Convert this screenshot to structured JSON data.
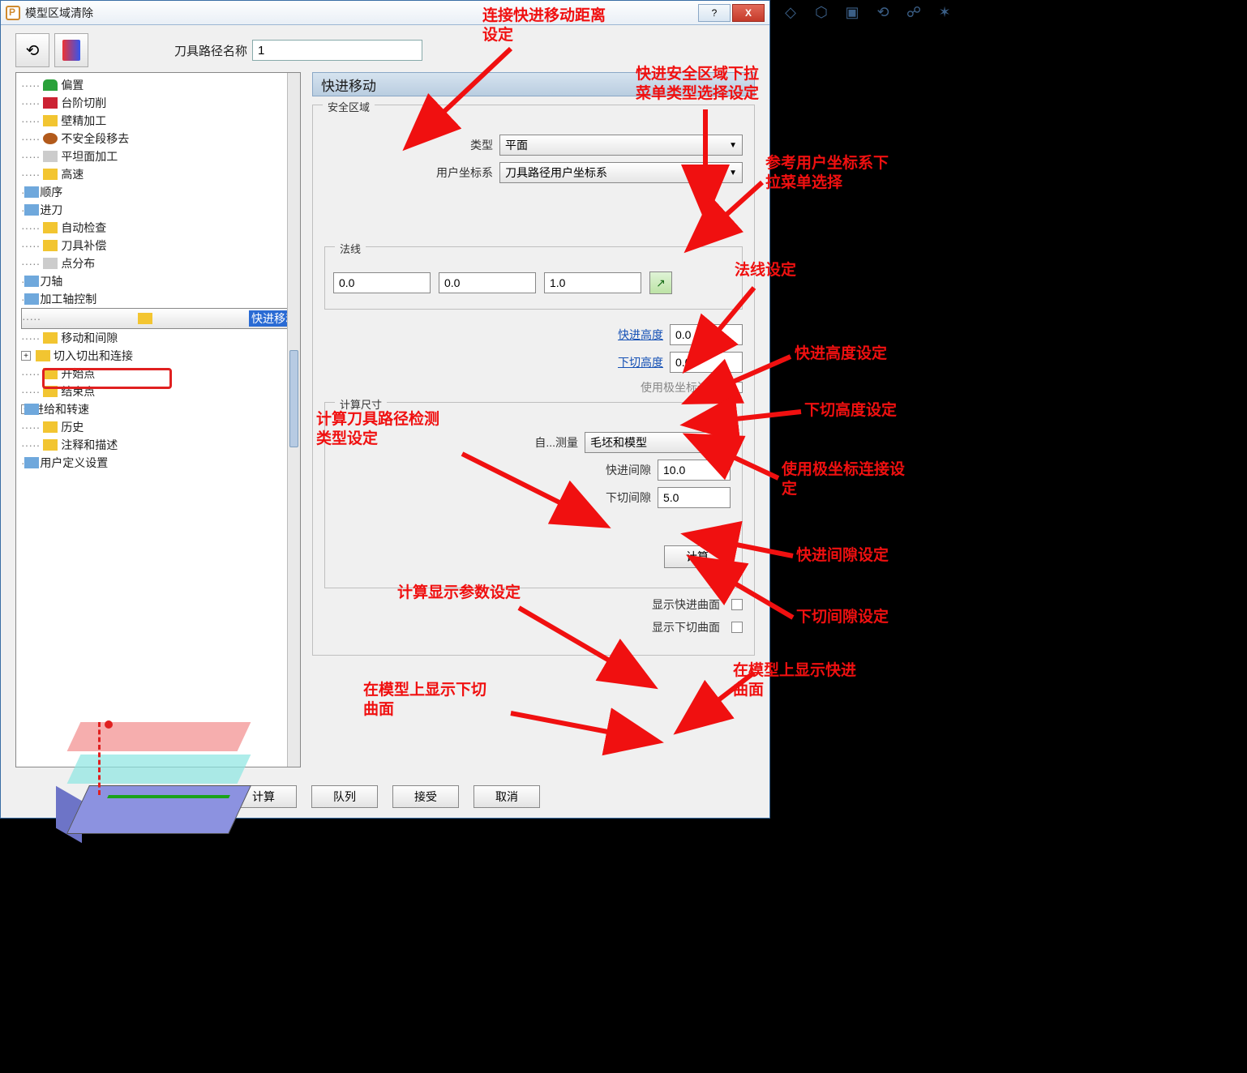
{
  "window": {
    "title": "模型区域清除",
    "help_glyph": "?",
    "close_glyph": "X"
  },
  "toolbar": {
    "name_label": "刀具路径名称",
    "name_value": "1"
  },
  "tree": {
    "items": [
      {
        "label": "偏置",
        "icon": "green"
      },
      {
        "label": "台阶切削",
        "icon": "stair"
      },
      {
        "label": "壁精加工",
        "icon": "yellow"
      },
      {
        "label": "不安全段移去",
        "icon": "brown"
      },
      {
        "label": "平坦面加工",
        "icon": "hash"
      },
      {
        "label": "高速",
        "icon": "fast"
      },
      {
        "label": "顺序",
        "icon": "arrow"
      },
      {
        "label": "进刀",
        "icon": "arrow"
      },
      {
        "label": "自动检查",
        "icon": "yellow"
      },
      {
        "label": "刀具补偿",
        "icon": "yellow"
      },
      {
        "label": "点分布",
        "icon": "hash"
      },
      {
        "label": "刀轴",
        "icon": "arrow"
      },
      {
        "label": "加工轴控制",
        "icon": "arrow"
      },
      {
        "label": "快进移动",
        "icon": "fast",
        "selected": true
      },
      {
        "label": "移动和间隙",
        "icon": "yellow"
      },
      {
        "label": "切入切出和连接",
        "icon": "yellow",
        "exp": "+"
      },
      {
        "label": "开始点",
        "icon": "yellow"
      },
      {
        "label": "结束点",
        "icon": "yellow"
      },
      {
        "label": "进给和转速",
        "icon": "arrow",
        "exp": "+"
      },
      {
        "label": "历史",
        "icon": "yellow"
      },
      {
        "label": "注释和描述",
        "icon": "yellow"
      },
      {
        "label": "用户定义设置",
        "icon": "arrow"
      }
    ]
  },
  "panel": {
    "title": "快进移动",
    "safe_title": "安全区域",
    "type_label": "类型",
    "type_value": "平面",
    "ucs_label": "用户坐标系",
    "ucs_value": "刀具路径用户坐标系",
    "normal_title": "法线",
    "normal_x": "0.0",
    "normal_y": "0.0",
    "normal_z": "1.0",
    "fast_h_label": "快进高度",
    "fast_h_value": "0.0",
    "plunge_h_label": "下切高度",
    "plunge_h_value": "0.0",
    "polar_label": "使用极坐标连接",
    "calc_title": "计算尺寸",
    "measure_label": "自...测量",
    "measure_value": "毛坯和模型",
    "fast_gap_label": "快进间隙",
    "fast_gap_value": "10.0",
    "plunge_gap_label": "下切间隙",
    "plunge_gap_value": "5.0",
    "calc_btn": "计算",
    "show_fast_label": "显示快进曲面",
    "show_plunge_label": "显示下切曲面"
  },
  "dlg": {
    "calc": "计算",
    "queue": "队列",
    "accept": "接受",
    "cancel": "取消"
  },
  "annotations": {
    "a1": "连接快进移动距离\n设定",
    "a2": "快进安全区域下拉\n菜单类型选择设定",
    "a3": "参考用户坐标系下\n拉菜单选择",
    "a4": "法线设定",
    "a5": "快进高度设定",
    "a6": "下切高度设定",
    "a7": "使用极坐标连接设\n定",
    "a8": "快进间隙设定",
    "a9": "下切间隙设定",
    "a10": "在模型上显示快进\n曲面",
    "a11": "计算刀具路径检测\n类型设定",
    "a12": "计算显示参数设定",
    "a13": "在模型上显示下切\n曲面"
  }
}
